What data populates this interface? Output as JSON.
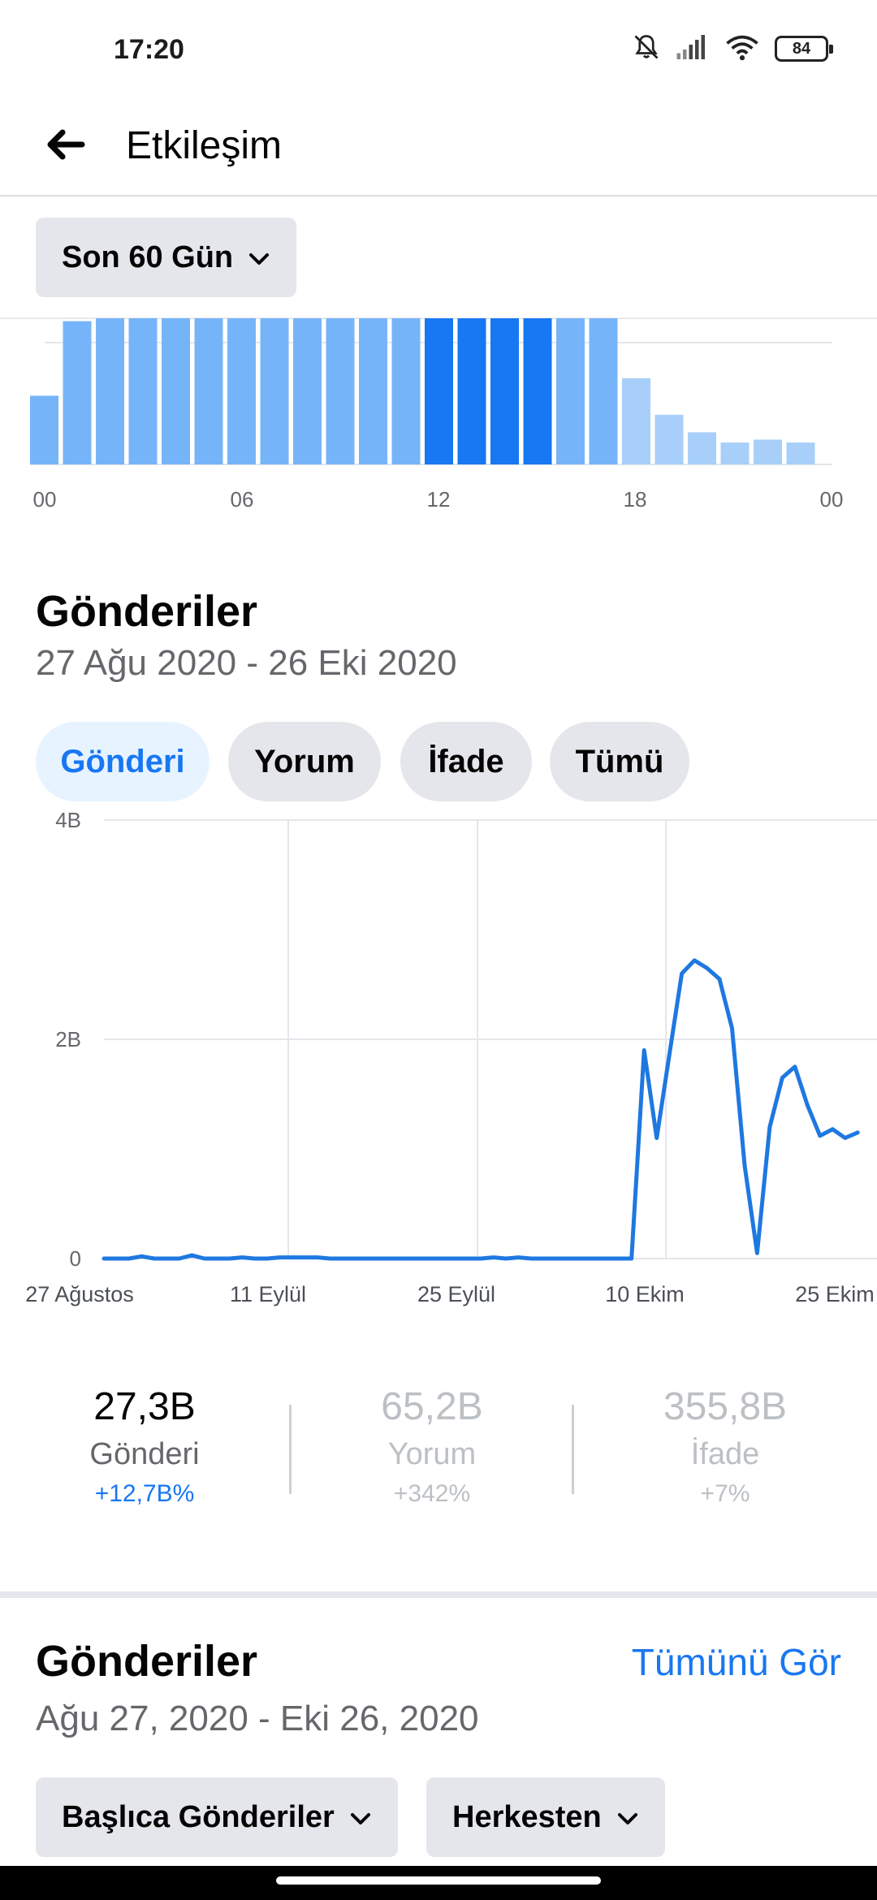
{
  "status_bar": {
    "time": "17:20",
    "battery": "84",
    "icons": [
      "bell-muted-icon",
      "signal-icon",
      "wifi-icon",
      "battery-icon"
    ]
  },
  "header": {
    "title": "Etkileşim",
    "back_icon": "arrow-left-icon"
  },
  "period_select": {
    "value": "Son 60 Gün",
    "icon": "chevron-down-icon"
  },
  "hour_chart": {
    "tick_labels": [
      "00",
      "06",
      "12",
      "18",
      "00"
    ]
  },
  "posts_section": {
    "title": "Gönderiler",
    "date_range": "27 Ağu 2020 - 26 Eki 2020",
    "tabs": [
      {
        "label": "Gönderi",
        "active": true
      },
      {
        "label": "Yorum",
        "active": false
      },
      {
        "label": "İfade",
        "active": false
      },
      {
        "label": "Tümü",
        "active": false
      }
    ]
  },
  "metrics": [
    {
      "value": "27,3B",
      "label": "Gönderi",
      "delta": "+12,7B%",
      "active": true
    },
    {
      "value": "65,2B",
      "label": "Yorum",
      "delta": "+342%",
      "active": false
    },
    {
      "value": "355,8B",
      "label": "İfade",
      "delta": "+7%",
      "active": false
    }
  ],
  "posts_list": {
    "title": "Gönderiler",
    "date_range": "Ağu 27, 2020 - Eki 26, 2020",
    "see_all": "Tümünü Gör",
    "filters": [
      {
        "label": "Başlıca Gönderiler",
        "icon": "chevron-down-icon"
      },
      {
        "label": "Herkesten",
        "icon": "chevron-down-icon"
      }
    ]
  },
  "colors": {
    "accent": "#1877f2",
    "bar_light": "#76b4fa",
    "bar_dark": "#1877f2",
    "bar_faint": "#a8cff9",
    "line": "#1e78e0"
  },
  "chart_data": [
    {
      "type": "bar",
      "categories": [
        "00",
        "01",
        "02",
        "03",
        "04",
        "05",
        "06",
        "07",
        "08",
        "09",
        "10",
        "11",
        "12",
        "13",
        "14",
        "15",
        "16",
        "17",
        "18",
        "19",
        "20",
        "21",
        "22",
        "23"
      ],
      "values": [
        47,
        98,
        100,
        100,
        100,
        100,
        100,
        100,
        100,
        100,
        100,
        100,
        100,
        100,
        100,
        100,
        100,
        100,
        59,
        34,
        22,
        15,
        17,
        15
      ],
      "highlight": [
        "12",
        "13",
        "14",
        "15"
      ],
      "tick_labels": [
        "00",
        "06",
        "12",
        "18",
        "00"
      ]
    },
    {
      "type": "line",
      "x_tick_labels": [
        "27 Ağustos",
        "11 Eylül",
        "25 Eylül",
        "10 Ekim",
        "25 Ekim"
      ],
      "y_tick_labels": [
        "0",
        "2B",
        "4B"
      ],
      "ylim": [
        0,
        4
      ],
      "series": [
        {
          "x": [
            "2020-08-27",
            "2020-08-28",
            "2020-08-29",
            "2020-08-30",
            "2020-08-31",
            "2020-09-01",
            "2020-09-02",
            "2020-09-03",
            "2020-09-04",
            "2020-09-05",
            "2020-09-06",
            "2020-09-07",
            "2020-09-08",
            "2020-09-09",
            "2020-09-10",
            "2020-09-11",
            "2020-09-12",
            "2020-09-13",
            "2020-09-14",
            "2020-09-15",
            "2020-09-16",
            "2020-09-17",
            "2020-09-18",
            "2020-09-19",
            "2020-09-20",
            "2020-09-21",
            "2020-09-22",
            "2020-09-23",
            "2020-09-24",
            "2020-09-25",
            "2020-09-26",
            "2020-09-27",
            "2020-09-28",
            "2020-09-29",
            "2020-09-30",
            "2020-10-01",
            "2020-10-02",
            "2020-10-03",
            "2020-10-04",
            "2020-10-05",
            "2020-10-06",
            "2020-10-07",
            "2020-10-08",
            "2020-10-09",
            "2020-10-10",
            "2020-10-11",
            "2020-10-12",
            "2020-10-13",
            "2020-10-14",
            "2020-10-15",
            "2020-10-16",
            "2020-10-17",
            "2020-10-18",
            "2020-10-19",
            "2020-10-20",
            "2020-10-21",
            "2020-10-22",
            "2020-10-23",
            "2020-10-24",
            "2020-10-25",
            "2020-10-26"
          ],
          "values": [
            0,
            0,
            0,
            0.02,
            0,
            0,
            0,
            0.03,
            0,
            0,
            0,
            0.01,
            0,
            0,
            0.01,
            0.01,
            0.01,
            0.01,
            0,
            0,
            0,
            0,
            0,
            0,
            0,
            0,
            0,
            0,
            0,
            0,
            0,
            0.01,
            0,
            0.01,
            0,
            0,
            0,
            0,
            0,
            0,
            0,
            0,
            0,
            1.9,
            1.1,
            1.85,
            2.6,
            2.72,
            2.65,
            2.55,
            2.1,
            0.85,
            0.05,
            1.2,
            1.65,
            1.75,
            1.4,
            1.12,
            1.18,
            1.1,
            1.15
          ]
        }
      ]
    }
  ]
}
